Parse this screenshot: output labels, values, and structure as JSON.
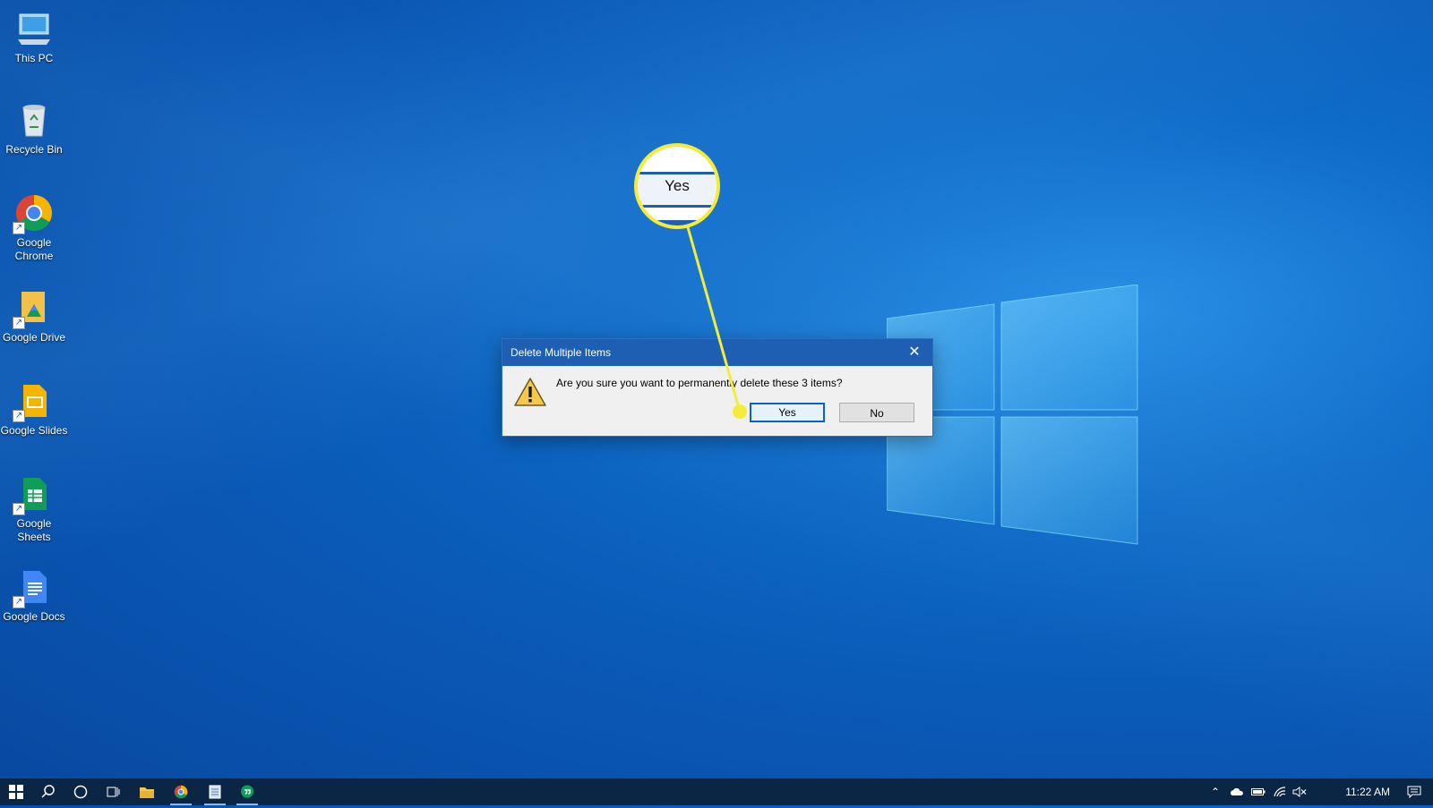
{
  "desktop": {
    "icons": [
      {
        "label": "This PC",
        "icon": "computer-icon"
      },
      {
        "label": "Recycle Bin",
        "icon": "recycle-bin-icon"
      },
      {
        "label": "Google Chrome",
        "icon": "chrome-icon"
      },
      {
        "label": "Google Drive",
        "icon": "google-drive-icon"
      },
      {
        "label": "Google Slides",
        "icon": "google-slides-icon"
      },
      {
        "label": "Google Sheets",
        "icon": "google-sheets-icon"
      },
      {
        "label": "Google Docs",
        "icon": "google-docs-icon"
      }
    ]
  },
  "dialog": {
    "title": "Delete Multiple Items",
    "close_label": "✕",
    "message": "Are you sure you want to permanently delete these 3 items?",
    "yes_label": "Yes",
    "no_label": "No"
  },
  "callout": {
    "label": "Yes",
    "color": "#f5ec3a"
  },
  "taskbar": {
    "pinned": [
      "windows-start-icon",
      "search-icon",
      "cortana-icon",
      "task-view-icon",
      "file-explorer-icon",
      "chrome-icon",
      "notepad-icon",
      "hangouts-icon"
    ],
    "clock": "11:22 AM"
  },
  "colors": {
    "titlebar": "#1e5fb3",
    "taskbar": "#0b2545",
    "accent": "#0a62c9"
  }
}
